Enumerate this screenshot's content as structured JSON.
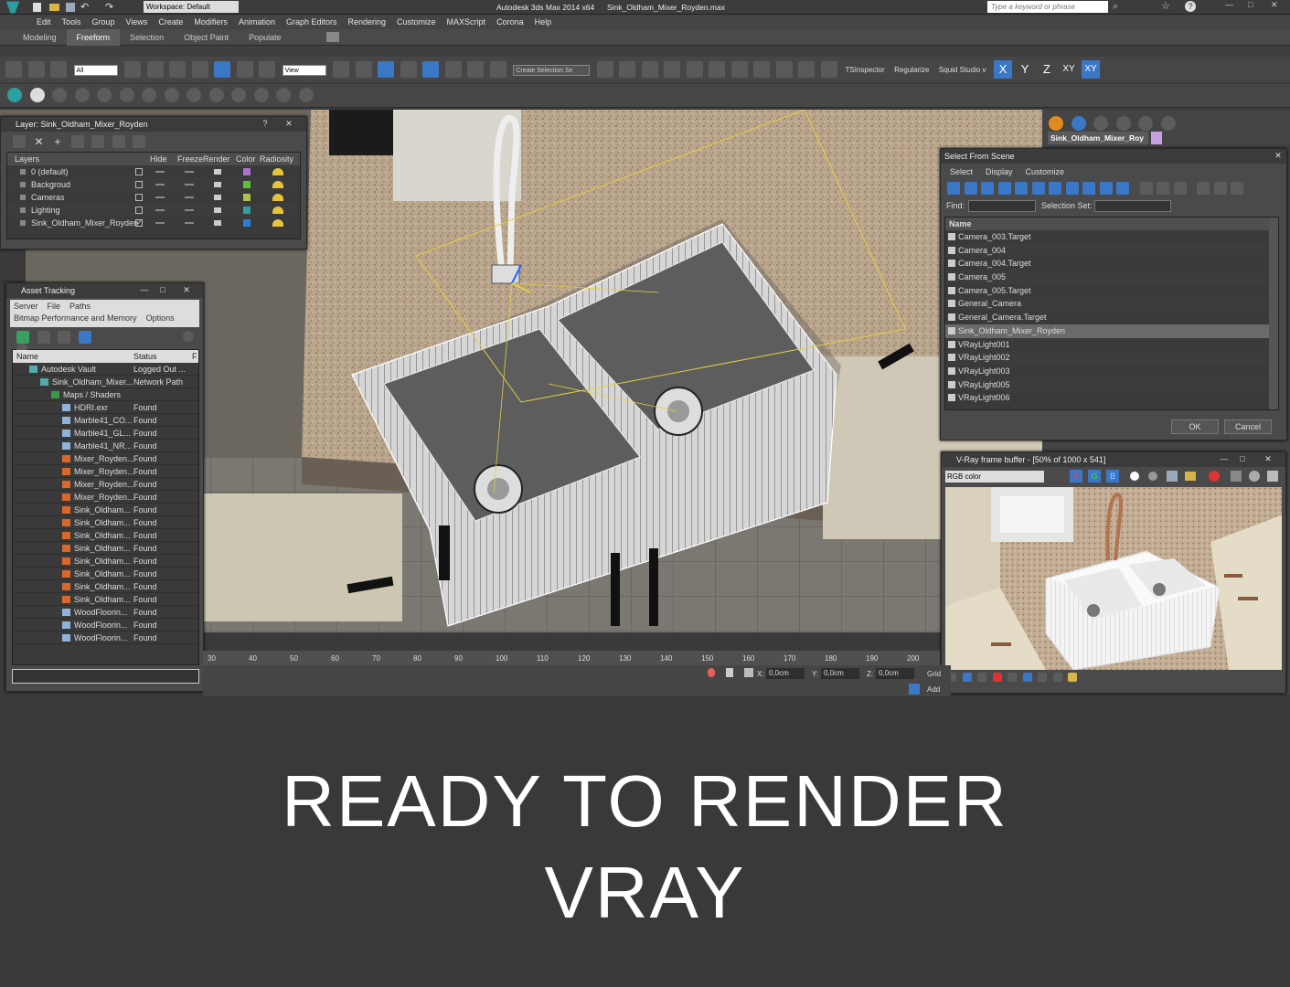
{
  "app": {
    "title": "Autodesk 3ds Max  2014 x64",
    "file": "Sink_Oldham_Mixer_Royden.max",
    "workspace": "Workspace: Default",
    "search_placeholder": "Type a keyword or phrase"
  },
  "menu": [
    "Edit",
    "Tools",
    "Group",
    "Views",
    "Create",
    "Modifiers",
    "Animation",
    "Graph Editors",
    "Rendering",
    "Customize",
    "MAXScript",
    "Corona",
    "Help"
  ],
  "ribbon_tabs": [
    {
      "label": "Modeling",
      "active": false
    },
    {
      "label": "Freeform",
      "active": true
    },
    {
      "label": "Selection",
      "active": false
    },
    {
      "label": "Object Paint",
      "active": false
    },
    {
      "label": "Populate",
      "active": false
    }
  ],
  "toolbar": {
    "filter_value": "All",
    "view_value": "View",
    "selection_set": "Create Selection Se",
    "tsinspector": "TSInspector",
    "regularize": "Regularize",
    "squid": "Squid Studio v",
    "axes": [
      {
        "label": "X",
        "on": true
      },
      {
        "label": "Y",
        "on": false
      },
      {
        "label": "Z",
        "on": false
      },
      {
        "label": "XY",
        "on": false
      },
      {
        "label": "XY",
        "on": true
      }
    ]
  },
  "layer_panel": {
    "title": "Layer: Sink_Oldham_Mixer_Royden",
    "columns": [
      "Layers",
      "Hide",
      "Freeze",
      "Render",
      "Color",
      "Radiosity"
    ],
    "rows": [
      {
        "name": "0 (default)",
        "color": "#b070d0",
        "checked": false
      },
      {
        "name": "Backgroud",
        "color": "#60c030",
        "checked": false
      },
      {
        "name": "Cameras",
        "color": "#b0c050",
        "checked": false
      },
      {
        "name": "Lighting",
        "color": "#30a0a0",
        "checked": false
      },
      {
        "name": "Sink_Oldham_Mixer_Royden",
        "color": "#2a7fd4",
        "checked": true
      }
    ]
  },
  "asset_panel": {
    "title": "Asset Tracking",
    "menu": [
      "Server",
      "File",
      "Paths"
    ],
    "menu2": [
      "Bitmap Performance and Memory",
      "Options"
    ],
    "columns": [
      "Name",
      "Status",
      "F"
    ],
    "rows": [
      {
        "name": "Autodesk Vault",
        "status": "Logged Out ...",
        "indent": 1
      },
      {
        "name": "Sink_Oldham_Mixer...",
        "status": "Network Path",
        "indent": 2
      },
      {
        "name": "Maps / Shaders",
        "status": "",
        "indent": 3
      },
      {
        "name": "HDRI.exr",
        "status": "Found",
        "indent": 4
      },
      {
        "name": "Marble41_CO...",
        "status": "Found",
        "indent": 4
      },
      {
        "name": "Marble41_GL...",
        "status": "Found",
        "indent": 4
      },
      {
        "name": "Marble41_NR...",
        "status": "Found",
        "indent": 4
      },
      {
        "name": "Mixer_Royden...",
        "status": "Found",
        "indent": 4
      },
      {
        "name": "Mixer_Royden...",
        "status": "Found",
        "indent": 4
      },
      {
        "name": "Mixer_Royden...",
        "status": "Found",
        "indent": 4
      },
      {
        "name": "Mixer_Royden...",
        "status": "Found",
        "indent": 4
      },
      {
        "name": "Sink_Oldham...",
        "status": "Found",
        "indent": 4
      },
      {
        "name": "Sink_Oldham...",
        "status": "Found",
        "indent": 4
      },
      {
        "name": "Sink_Oldham...",
        "status": "Found",
        "indent": 4
      },
      {
        "name": "Sink_Oldham...",
        "status": "Found",
        "indent": 4
      },
      {
        "name": "Sink_Oldham...",
        "status": "Found",
        "indent": 4
      },
      {
        "name": "Sink_Oldham...",
        "status": "Found",
        "indent": 4
      },
      {
        "name": "Sink_Oldham...",
        "status": "Found",
        "indent": 4
      },
      {
        "name": "Sink_Oldham...",
        "status": "Found",
        "indent": 4
      },
      {
        "name": "WoodFloorin...",
        "status": "Found",
        "indent": 4
      },
      {
        "name": "WoodFloorin...",
        "status": "Found",
        "indent": 4
      },
      {
        "name": "WoodFloorin...",
        "status": "Found",
        "indent": 4
      }
    ]
  },
  "select_panel": {
    "title": "Select From Scene",
    "menu": [
      "Select",
      "Display",
      "Customize"
    ],
    "find_label": "Find:",
    "selection_set_label": "Selection Set:",
    "column": "Name",
    "rows": [
      {
        "name": "Camera_003.Target",
        "selected": false
      },
      {
        "name": "Camera_004",
        "selected": false
      },
      {
        "name": "Camera_004.Target",
        "selected": false
      },
      {
        "name": "Camera_005",
        "selected": false
      },
      {
        "name": "Camera_005.Target",
        "selected": false
      },
      {
        "name": "General_Camera",
        "selected": false
      },
      {
        "name": "General_Camera.Target",
        "selected": false
      },
      {
        "name": "Sink_Oldham_Mixer_Royden",
        "selected": true
      },
      {
        "name": "VRayLight001",
        "selected": false
      },
      {
        "name": "VRayLight002",
        "selected": false
      },
      {
        "name": "VRayLight003",
        "selected": false
      },
      {
        "name": "VRayLight005",
        "selected": false
      },
      {
        "name": "VRayLight006",
        "selected": false
      }
    ],
    "ok": "OK",
    "cancel": "Cancel"
  },
  "vfb": {
    "title": "V-Ray frame buffer - [50% of 1000 x 541]",
    "channel": "RGB color"
  },
  "command_panel": {
    "object_name": "Sink_Oldham_Mixer_Roy"
  },
  "timeline": {
    "ticks": [
      "30",
      "40",
      "50",
      "60",
      "70",
      "80",
      "90",
      "100",
      "110",
      "120",
      "130",
      "140",
      "150",
      "160",
      "170",
      "180",
      "190",
      "200"
    ]
  },
  "status": {
    "x_label": "X:",
    "x": "0,0cm",
    "y_label": "Y:",
    "y": "0,0cm",
    "z_label": "Z:",
    "z": "0,0cm",
    "grid": "Grid",
    "add": "Add"
  },
  "banner": {
    "line1": "READY TO RENDER",
    "line2": "VRAY"
  }
}
